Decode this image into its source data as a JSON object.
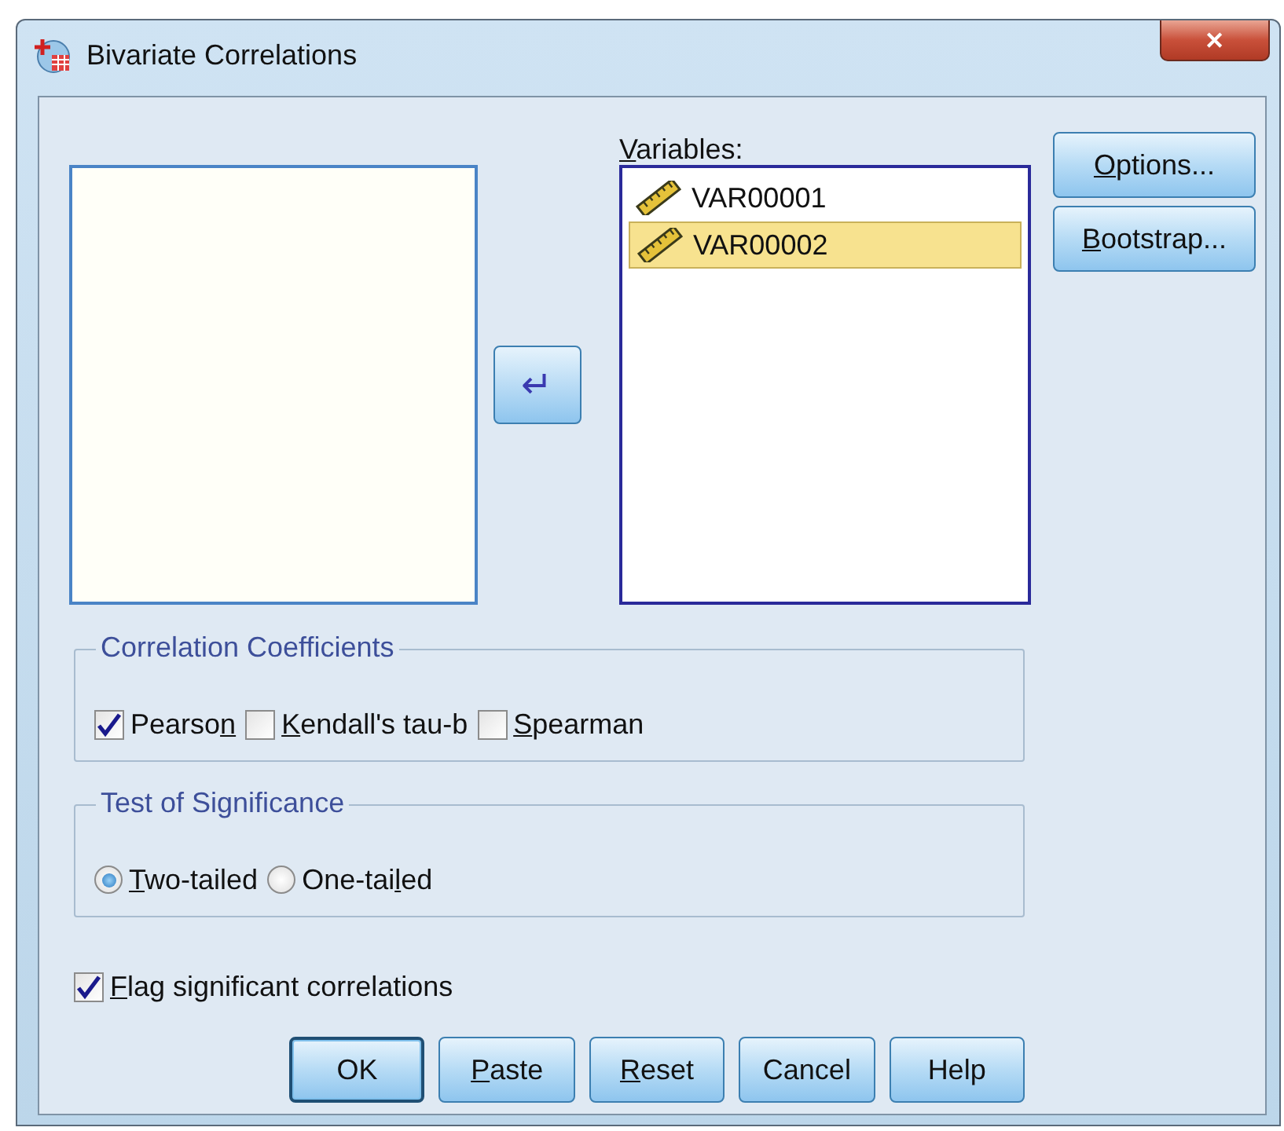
{
  "window": {
    "title": "Bivariate Correlations",
    "close": "✕"
  },
  "move_button": {
    "glyph": "↵"
  },
  "variables": {
    "label": {
      "key": "V",
      "post": "ariables:"
    },
    "items": [
      {
        "name": "VAR00001",
        "selected": false
      },
      {
        "name": "VAR00002",
        "selected": true
      }
    ]
  },
  "side_buttons": [
    {
      "label": {
        "key": "O",
        "post": "ptions..."
      }
    },
    {
      "label": {
        "key": "B",
        "post": "ootstrap..."
      }
    }
  ],
  "correlation_coefficients": {
    "title": "Correlation Coefficients",
    "options": [
      {
        "label": {
          "pre": "Pearso",
          "key": "n"
        },
        "checked": true
      },
      {
        "label": {
          "key": "K",
          "post": "endall's tau-b"
        },
        "checked": false
      },
      {
        "label": {
          "key": "S",
          "post": "pearman"
        },
        "checked": false
      }
    ]
  },
  "test_of_significance": {
    "title": "Test of Significance",
    "options": [
      {
        "label": {
          "key": "T",
          "post": "wo-tailed"
        },
        "selected": true
      },
      {
        "label": {
          "pre": "One-tai",
          "key": "l",
          "post": "ed"
        },
        "selected": false
      }
    ]
  },
  "flag": {
    "label": {
      "key": "F",
      "post": "lag significant correlations"
    },
    "checked": true
  },
  "buttons": [
    {
      "label": {
        "pre": "OK"
      },
      "default": true
    },
    {
      "label": {
        "key": "P",
        "post": "aste"
      },
      "default": false
    },
    {
      "label": {
        "key": "R",
        "post": "eset"
      },
      "default": false
    },
    {
      "label": {
        "pre": "Cancel"
      },
      "default": false
    },
    {
      "label": {
        "pre": "Help"
      },
      "default": false
    }
  ]
}
